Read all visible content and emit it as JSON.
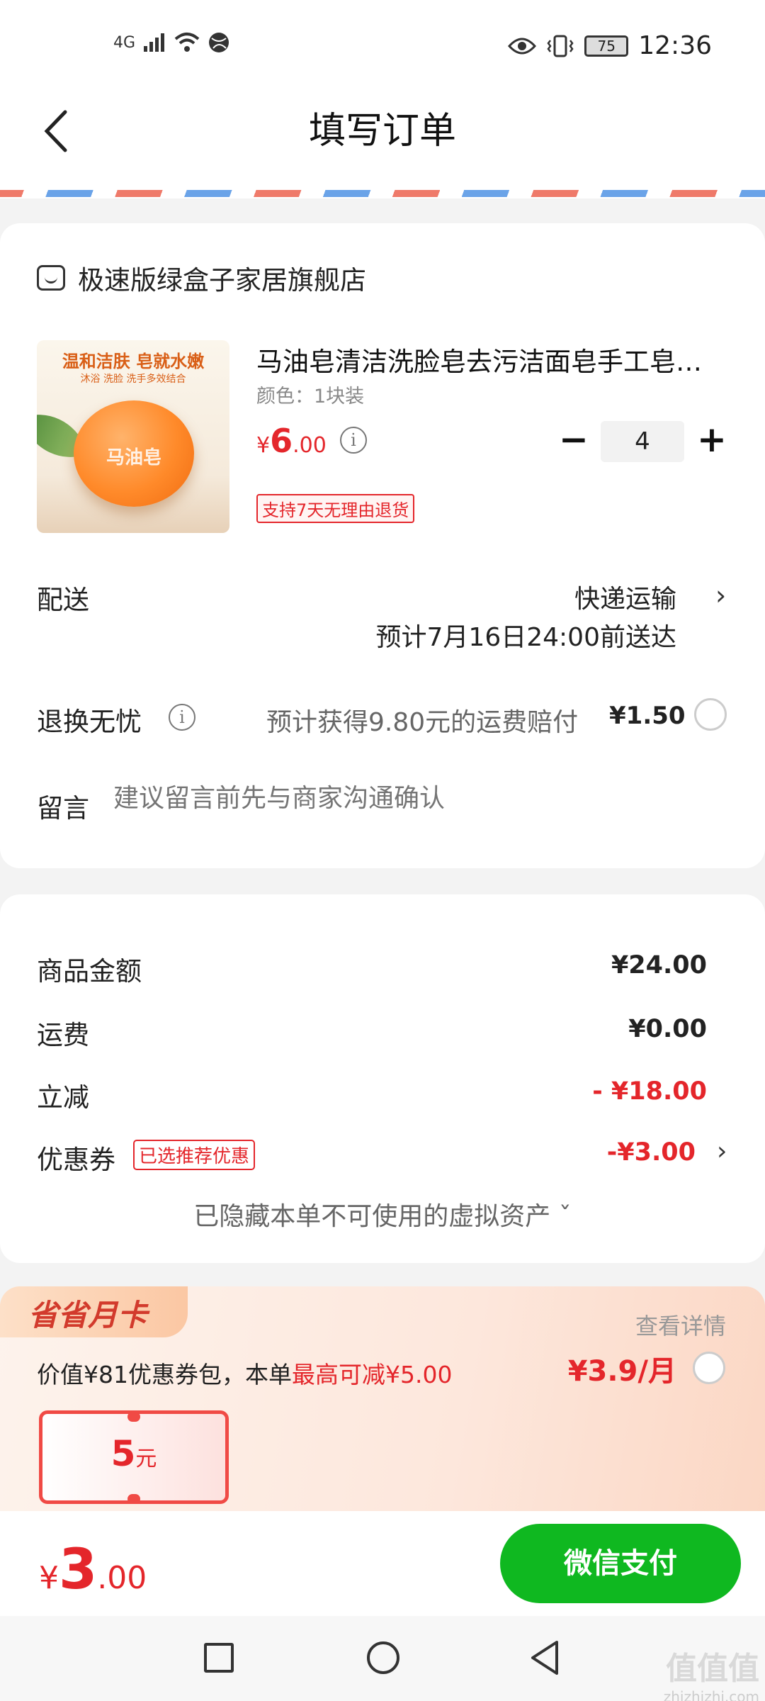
{
  "status_bar": {
    "network": "4G",
    "battery": "75",
    "time": "12:36"
  },
  "header": {
    "title": "填写订单"
  },
  "store": {
    "name": "极速版绿盒子家居旗舰店"
  },
  "product": {
    "title": "马油皂清洁洗脸皂去污洁面皂手工皂…",
    "spec": "颜色：1块装",
    "price_currency": "¥",
    "price_int": "6",
    "price_dec": ".00",
    "quantity": "4",
    "return_tag": "支持7天无理由退货",
    "image_slogan": "温和洁肤 皂就水嫩",
    "image_subslogan": "沐浴 洗脸 洗手多效结合",
    "image_brand": "马油皂"
  },
  "delivery": {
    "label": "配送",
    "method": "快递运输",
    "eta": "预计7月16日24:00前送达"
  },
  "return_worry": {
    "label": "退换无忧",
    "desc": "预计获得9.80元的运费赔付",
    "fee": "¥1.50"
  },
  "message": {
    "label": "留言",
    "placeholder": "建议留言前先与商家沟通确认"
  },
  "summary": {
    "goods_label": "商品金额",
    "goods_value": "¥24.00",
    "shipping_label": "运费",
    "shipping_value": "¥0.00",
    "discount_label": "立减",
    "discount_value": "- ¥18.00",
    "coupon_label": "优惠券",
    "coupon_tag": "已选推荐优惠",
    "coupon_value": "-¥3.00",
    "hidden_assets": "已隐藏本单不可使用的虚拟资产 ˇ"
  },
  "month_card": {
    "badge": "省省月卡",
    "view_detail": "查看详情",
    "desc_prefix": "价值¥81优惠券包，本单",
    "desc_highlight": "最高可减¥5.00",
    "price": "¥3.9/月",
    "voucher_amount": "5",
    "voucher_unit": "元"
  },
  "paybar": {
    "currency": "¥",
    "total_int": "3",
    "total_dec": ".00",
    "pay_button": "微信支付"
  },
  "watermark": {
    "main": "值值值",
    "sub": "zhizhizhi.com"
  },
  "colors": {
    "accent_red": "#e4262b",
    "pay_green": "#0fb820"
  }
}
